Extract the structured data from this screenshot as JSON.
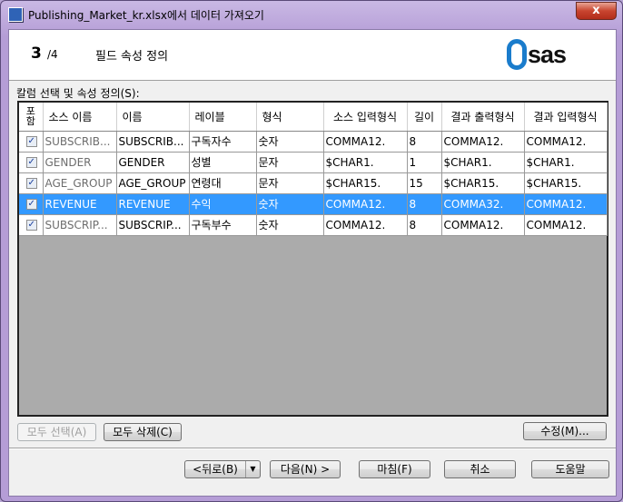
{
  "window": {
    "title": "Publishing_Market_kr.xlsx에서 데이터 가져오기",
    "close": "x"
  },
  "header": {
    "step": "3",
    "total": "/4",
    "title": "필드 속성 정의",
    "logo": "sas"
  },
  "grid_label": "칼럼 선택 및 속성 정의(S):",
  "columns": [
    "포\n함",
    "소스 이름",
    "이름",
    "레이블",
    "형식",
    "소스 입력형식",
    "길이",
    "결과 출력형식",
    "결과 입력형식"
  ],
  "rows": [
    {
      "include": true,
      "source": "SUBSCRIB...",
      "name": "SUBSCRIB...",
      "label": "구독자수",
      "type": "숫자",
      "informat": "COMMA12.",
      "length": "8",
      "format": "COMMA12.",
      "out_informat": "COMMA12."
    },
    {
      "include": true,
      "source": "GENDER",
      "name": "GENDER",
      "label": "성별",
      "type": "문자",
      "informat": "$CHAR1.",
      "length": "1",
      "format": "$CHAR1.",
      "out_informat": "$CHAR1."
    },
    {
      "include": true,
      "source": "AGE_GROUP",
      "name": "AGE_GROUP",
      "label": "연령대",
      "type": "문자",
      "informat": "$CHAR15.",
      "length": "15",
      "format": "$CHAR15.",
      "out_informat": "$CHAR15."
    },
    {
      "include": true,
      "source": "REVENUE",
      "name": "REVENUE",
      "label": "수익",
      "type": "숫자",
      "informat": "COMMA12.",
      "length": "8",
      "format": "COMMA32.",
      "out_informat": "COMMA12.",
      "selected": true
    },
    {
      "include": true,
      "source": "SUBSCRIP...",
      "name": "SUBSCRIP...",
      "label": "구독부수",
      "type": "숫자",
      "informat": "COMMA12.",
      "length": "8",
      "format": "COMMA12.",
      "out_informat": "COMMA12."
    }
  ],
  "buttons": {
    "select_all": "모두 선택(A)",
    "clear_all": "모두 삭제(C)",
    "modify": "수정(M)...",
    "back": "<뒤로(B)",
    "next": "다음(N) >",
    "finish": "마침(F)",
    "cancel": "취소",
    "help": "도움말"
  }
}
